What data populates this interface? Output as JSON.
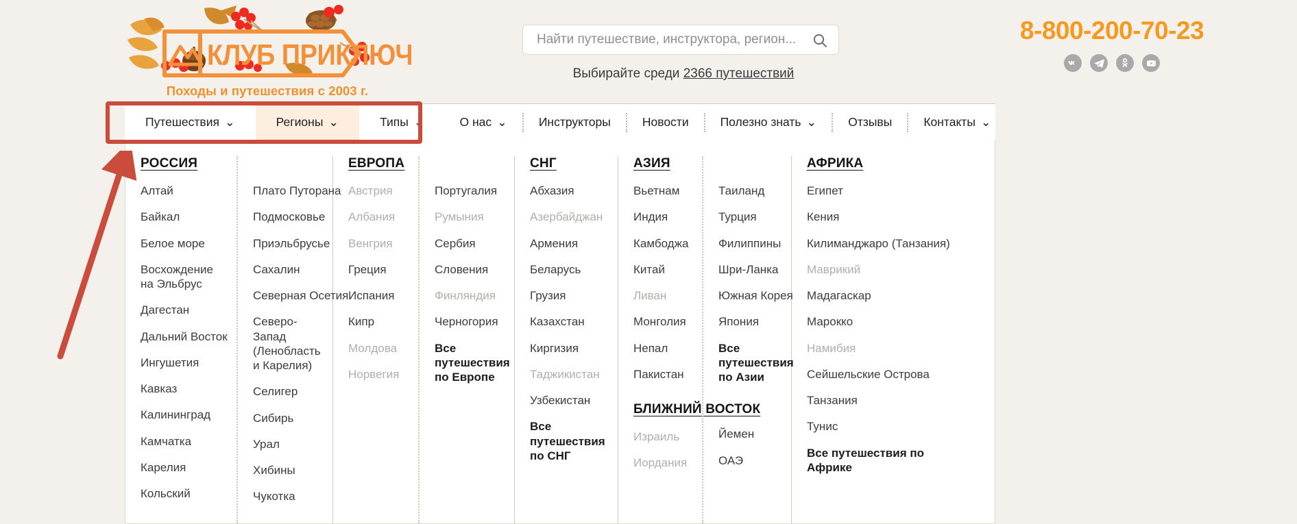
{
  "header": {
    "logo": {
      "brand": "КЛУБ ПРИКЛЮЧЕНИЙ",
      "tagline": "Походы и путешествия с 2003 г."
    },
    "search": {
      "placeholder": "Найти путешествие, инструктора, регион...",
      "value": "",
      "sub_prefix": "Выбирайте среди ",
      "sub_link": "2366 путешествий"
    },
    "phone": "8-800-200-70-23",
    "socials": [
      {
        "name": "vk",
        "label": "VK"
      },
      {
        "name": "telegram",
        "label": "Telegram"
      },
      {
        "name": "odnoklassniki",
        "label": "Одноклассники"
      },
      {
        "name": "youtube",
        "label": "YouTube"
      }
    ]
  },
  "nav": {
    "items": [
      {
        "label": "Путешествия",
        "caret": "⌄",
        "highlighted": false,
        "boxed": true
      },
      {
        "label": "Регионы",
        "caret": "⌄",
        "highlighted": true,
        "boxed": true
      },
      {
        "label": "Типы",
        "caret": "⌄",
        "highlighted": false,
        "boxed": true
      },
      {
        "label": "О нас",
        "caret": "⌄",
        "highlighted": false,
        "boxed": false
      },
      {
        "label": "Инструкторы",
        "caret": "",
        "highlighted": false,
        "boxed": false
      },
      {
        "label": "Новости",
        "caret": "",
        "highlighted": false,
        "boxed": false
      },
      {
        "label": "Полезно знать",
        "caret": "⌄",
        "highlighted": false,
        "boxed": false
      },
      {
        "label": "Отзывы",
        "caret": "",
        "highlighted": false,
        "boxed": false
      },
      {
        "label": "Контакты",
        "caret": "⌄",
        "highlighted": false,
        "boxed": false
      }
    ]
  },
  "annotation": {
    "color": "#c94c3c",
    "shape": "rectangle-with-arrow",
    "target": "Путешествия / Регионы / Типы"
  },
  "mega_menu": {
    "regions": [
      {
        "title": "РОССИЯ",
        "columns": [
          {
            "items": [
              {
                "label": "Алтай",
                "dim": false
              },
              {
                "label": "Байкал",
                "dim": false
              },
              {
                "label": "Белое море",
                "dim": false
              },
              {
                "label": "Восхождение на Эльбрус",
                "dim": false,
                "multi": true
              },
              {
                "label": "Дагестан",
                "dim": false
              },
              {
                "label": "Дальний Восток",
                "dim": false
              },
              {
                "label": "Ингушетия",
                "dim": false
              },
              {
                "label": "Кавказ",
                "dim": false
              },
              {
                "label": "Калининград",
                "dim": false
              },
              {
                "label": "Камчатка",
                "dim": false
              },
              {
                "label": "Карелия",
                "dim": false
              },
              {
                "label": "Кольский",
                "dim": false
              }
            ]
          },
          {
            "items": [
              {
                "label": "Плато Путорана",
                "dim": false
              },
              {
                "label": "Подмосковье",
                "dim": false
              },
              {
                "label": "Приэльбрусье",
                "dim": false
              },
              {
                "label": "Сахалин",
                "dim": false
              },
              {
                "label": "Северная Осетия",
                "dim": false
              },
              {
                "label": "Северо-Запад (Ленобласть и Карелия)",
                "dim": false,
                "multi": true
              },
              {
                "label": "Селигер",
                "dim": false
              },
              {
                "label": "Сибирь",
                "dim": false
              },
              {
                "label": "Урал",
                "dim": false
              },
              {
                "label": "Хибины",
                "dim": false
              },
              {
                "label": "Чукотка",
                "dim": false
              }
            ]
          }
        ]
      },
      {
        "title": "ЕВРОПА",
        "columns": [
          {
            "items": [
              {
                "label": "Австрия",
                "dim": true
              },
              {
                "label": "Албания",
                "dim": true
              },
              {
                "label": "Венгрия",
                "dim": true
              },
              {
                "label": "Греция",
                "dim": false
              },
              {
                "label": "Испания",
                "dim": false
              },
              {
                "label": "Кипр",
                "dim": false
              },
              {
                "label": "Молдова",
                "dim": true
              },
              {
                "label": "Норвегия",
                "dim": true
              }
            ]
          },
          {
            "items": [
              {
                "label": "Португалия",
                "dim": false
              },
              {
                "label": "Румыния",
                "dim": true
              },
              {
                "label": "Сербия",
                "dim": false
              },
              {
                "label": "Словения",
                "dim": false
              },
              {
                "label": "Финляндия",
                "dim": true
              },
              {
                "label": "Черногория",
                "dim": false
              },
              {
                "label": "Все путешествия по Европе",
                "dim": false,
                "strong": true
              }
            ]
          }
        ]
      },
      {
        "title": "СНГ",
        "columns": [
          {
            "items": [
              {
                "label": "Абхазия",
                "dim": false
              },
              {
                "label": "Азербайджан",
                "dim": true
              },
              {
                "label": "Армения",
                "dim": false
              },
              {
                "label": "Беларусь",
                "dim": false
              },
              {
                "label": "Грузия",
                "dim": false
              },
              {
                "label": "Казахстан",
                "dim": false
              },
              {
                "label": "Киргизия",
                "dim": false
              },
              {
                "label": "Таджикистан",
                "dim": true
              },
              {
                "label": "Узбекистан",
                "dim": false
              },
              {
                "label": "Все путешествия по СНГ",
                "dim": false,
                "strong": true
              }
            ]
          }
        ]
      },
      {
        "title": "АЗИЯ",
        "title2": "БЛИЖНИЙ ВОСТОК",
        "columns": [
          {
            "items": [
              {
                "label": "Вьетнам",
                "dim": false
              },
              {
                "label": "Индия",
                "dim": false
              },
              {
                "label": "Камбоджа",
                "dim": false
              },
              {
                "label": "Китай",
                "dim": false
              },
              {
                "label": "Ливан",
                "dim": true
              },
              {
                "label": "Монголия",
                "dim": false
              },
              {
                "label": "Непал",
                "dim": false
              },
              {
                "label": "Пакистан",
                "dim": false
              }
            ],
            "items2": [
              {
                "label": "Израиль",
                "dim": true
              },
              {
                "label": "Иордания",
                "dim": true
              }
            ]
          },
          {
            "items": [
              {
                "label": "Таиланд",
                "dim": false
              },
              {
                "label": "Турция",
                "dim": false
              },
              {
                "label": "Филиппины",
                "dim": false
              },
              {
                "label": "Шри-Ланка",
                "dim": false
              },
              {
                "label": "Южная Корея",
                "dim": false
              },
              {
                "label": "Япония",
                "dim": false
              },
              {
                "label": "Все путешествия по Азии",
                "dim": false,
                "strong": true
              }
            ],
            "items2": [
              {
                "label": "Йемен",
                "dim": false
              },
              {
                "label": "ОАЭ",
                "dim": false
              }
            ]
          }
        ]
      },
      {
        "title": "АФРИКА",
        "columns": [
          {
            "items": [
              {
                "label": "Египет",
                "dim": false
              },
              {
                "label": "Кения",
                "dim": false
              },
              {
                "label": "Килиманджаро (Танзания)",
                "dim": false
              },
              {
                "label": "Маврикий",
                "dim": true
              },
              {
                "label": "Мадагаскар",
                "dim": false
              },
              {
                "label": "Марокко",
                "dim": false
              },
              {
                "label": "Намибия",
                "dim": true
              },
              {
                "label": "Сейшельские Острова",
                "dim": false
              },
              {
                "label": "Танзания",
                "dim": false
              },
              {
                "label": "Тунис",
                "dim": false
              },
              {
                "label": "Все путешествия по Африке",
                "dim": false,
                "strong": true
              }
            ]
          }
        ]
      }
    ]
  }
}
